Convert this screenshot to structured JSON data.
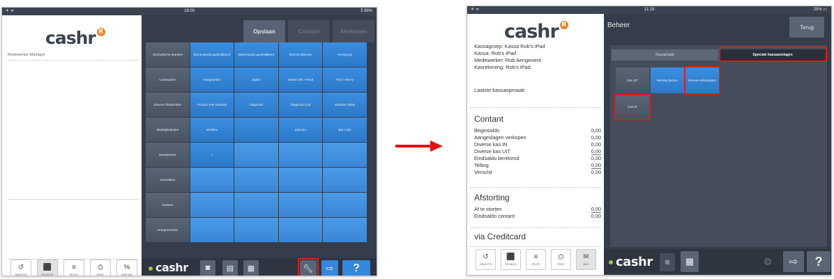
{
  "screen1": {
    "status": {
      "left": "✈ ᯤ",
      "time": "18:00",
      "battery": "⁑ 89%"
    },
    "logo": "cashr",
    "logo_mark": "R",
    "employee": "Medewerker Manager",
    "top_buttons": [
      "Opslaan",
      "Contant",
      "Afrekenen"
    ],
    "grid": [
      [
        "Alcoholische dranken",
        "Binnenlands gedestilleerd",
        "Buitenlands gedestilleerd",
        "Diverse likeuren",
        "Hertog jan"
      ],
      [
        "Cadeaubon",
        "Hoegaarden",
        "Jupiler",
        "Martini Wit / Rood",
        "Port / sherry"
      ],
      [
        "Diverse frisdranken",
        "Product met eenheid",
        "Slagroom",
        "Slagroom 0,5l",
        "Wieckse Witte"
      ],
      [
        "Maaltijdsalades",
        "Wokline",
        "",
        "Ipad pro",
        "Bar code"
      ],
      [
        "Sandwiches",
        "+",
        "",
        "",
        ""
      ],
      [
        "Smoothies",
        "",
        "",
        "",
        ""
      ],
      [
        "Soepen",
        "",
        "",
        "",
        ""
      ],
      [
        "Voorgerechten",
        "",
        "",
        "",
        ""
      ]
    ],
    "footer_tools": [
      {
        "icon": "↺",
        "label": "ONDO/TIE"
      },
      {
        "icon": "⬛",
        "label": "OPHALEN"
      },
      {
        "icon": "≡",
        "label": "SPLITS"
      },
      {
        "icon": "⎙",
        "label": "PRINT"
      },
      {
        "icon": "%",
        "label": "KORTING"
      }
    ],
    "bottom_logo": "cashr",
    "help": "?"
  },
  "screen2": {
    "status": {
      "left": "✈ ᯤ",
      "time": "11:19",
      "battery": "25% ▭"
    },
    "logo": "cashr",
    "logo_mark": "R",
    "info_lines": [
      "Kassagroep: Kassa Rob's iPad",
      "Kassa: Rob's iPad",
      "Medewerker: Rob  Aengenent",
      "Kasrekening: Rob's iPad"
    ],
    "last_open_label": "Laatste kassaopmaak:",
    "contant": {
      "title": "Contant",
      "rows": [
        {
          "label": "Beginsaldo",
          "value": "0,00"
        },
        {
          "label": "Aangeslagen verkopen",
          "value": "0,00"
        },
        {
          "label": "Diverse kas IN",
          "value": "0,00"
        },
        {
          "label": "Diverse kas UIT",
          "value": "0,00"
        },
        {
          "label": "Eindsaldo berekend",
          "value": "0,00"
        },
        {
          "label": "Telling",
          "value": "0,00"
        },
        {
          "label": "Verschil",
          "value": "0,00"
        }
      ]
    },
    "afstorting": {
      "title": "Afstorting",
      "rows": [
        {
          "label": "Af te storten",
          "value": "0,00"
        },
        {
          "label": "Eindsaldo contant",
          "value": "0,00"
        }
      ]
    },
    "creditcard_title": "via Creditcard",
    "header_title": "Beheer",
    "back_button": "Terug",
    "tabs": [
      "Kasopmaak",
      "Speciale kassaanslagen"
    ],
    "tiles": [
      "Kas UIT",
      "Betaling factuur",
      "Diverse ontvangsten",
      "Kas IN"
    ],
    "footer_tools": [
      {
        "icon": "↺",
        "label": "ONDO/TIE"
      },
      {
        "icon": "⬛",
        "label": "OPHALEN"
      },
      {
        "icon": "≡",
        "label": "SPLITS"
      },
      {
        "icon": "⎙",
        "label": "PRINT"
      },
      {
        "icon": "✉",
        "label": "MAIL"
      }
    ],
    "bottom_logo": "cashr",
    "help": "?"
  },
  "colors": {
    "highlight": "#e11b1b",
    "arrow": "#e3110f",
    "tile_blue": "#2f80d6",
    "panel": "#363d4a",
    "accent_green": "#9ccb3b",
    "logo_orange": "#f58220"
  }
}
